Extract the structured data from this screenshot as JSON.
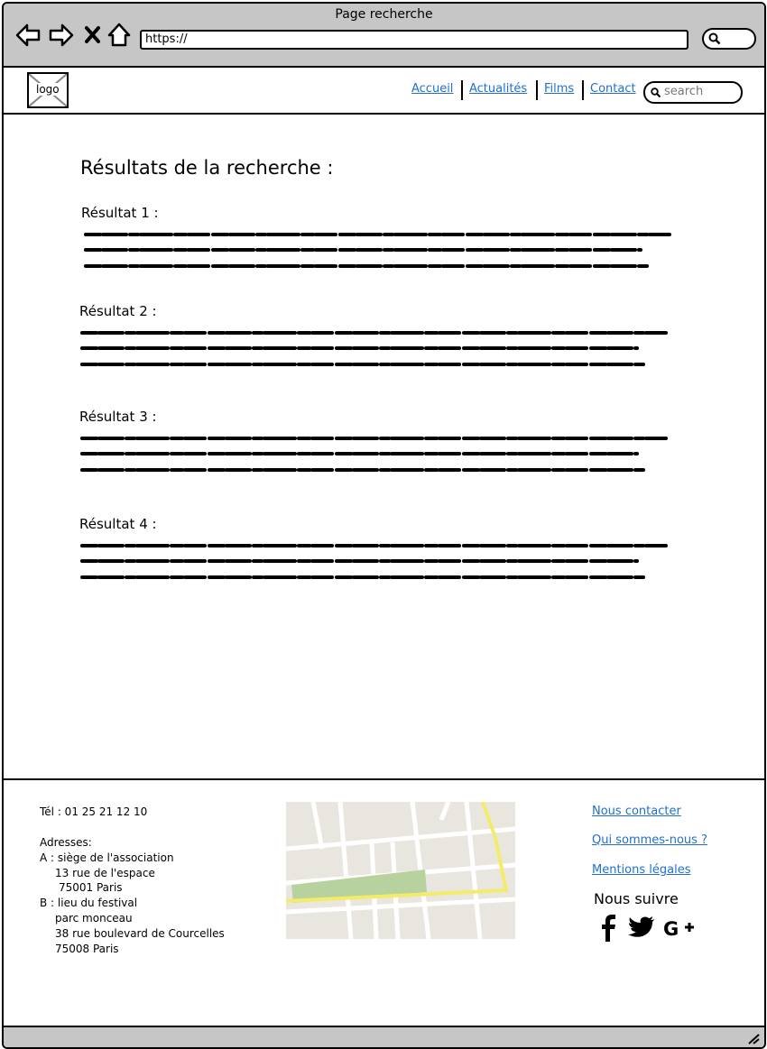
{
  "window": {
    "title": "Page recherche",
    "url": "https://"
  },
  "header": {
    "logo_label": "logo",
    "nav": [
      "Accueil",
      "Actualités",
      "Films",
      "Contact"
    ],
    "search_placeholder": "search"
  },
  "main": {
    "title": "Résultats de la recherche :",
    "results": [
      {
        "label": "Résultat 1 :"
      },
      {
        "label": "Résultat 2 :"
      },
      {
        "label": "Résultat 3 :"
      },
      {
        "label": "Résultat 4 :"
      }
    ]
  },
  "footer": {
    "phone": "Tél : 01 25 21 12 10",
    "addresses_label": "Adresses:",
    "address_a": [
      "A : siège de l'association",
      "13 rue de l'espace",
      "75001 Paris"
    ],
    "address_b": [
      "B : lieu du festival",
      "parc monceau",
      "38 rue boulevard de Courcelles",
      "75008 Paris"
    ],
    "links": [
      "Nous contacter",
      "Qui sommes-nous ?",
      "Mentions légales"
    ],
    "follow": "Nous suivre",
    "social_icons": [
      "facebook-icon",
      "twitter-icon",
      "google-plus-icon"
    ]
  },
  "colors": {
    "link": "#1f6fcf",
    "chrome": "#c6c6c6",
    "map_park": "#b7d19f",
    "map_road": "#f3ec6b"
  }
}
